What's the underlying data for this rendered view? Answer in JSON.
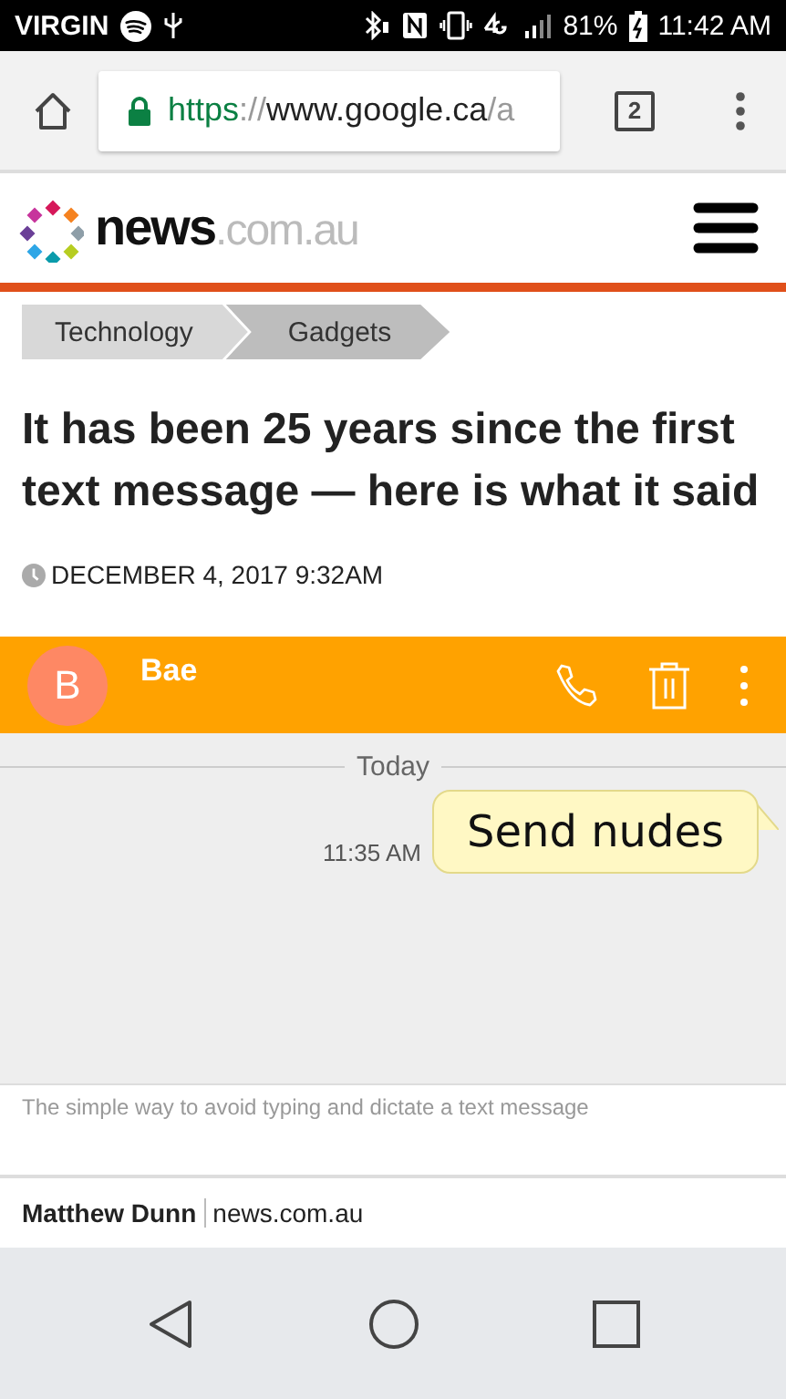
{
  "status_bar": {
    "carrier": "VIRGIN",
    "battery": "81%",
    "time": "11:42 AM"
  },
  "browser": {
    "url": {
      "scheme": "https",
      "separator": "://",
      "host": "www.google.ca",
      "path": "/a"
    },
    "tab_count": "2"
  },
  "site_header": {
    "logo": {
      "name": "news",
      "suffix": ".com.au"
    }
  },
  "breadcrumbs": [
    "Technology",
    "Gadgets"
  ],
  "article": {
    "headline": "It has been 25 years since the first text message — here is what it said",
    "date": "DECEMBER 4, 2017 9:32AM",
    "image": {
      "contact": {
        "initial": "B",
        "name": "Bae"
      },
      "divider_label": "Today",
      "messages": [
        {
          "time": "11:35 AM",
          "text": "Send nudes"
        }
      ]
    },
    "caption": "The simple way to avoid typing and dictate a text message",
    "byline": {
      "author": "Matthew Dunn",
      "source": "news.com.au"
    }
  }
}
